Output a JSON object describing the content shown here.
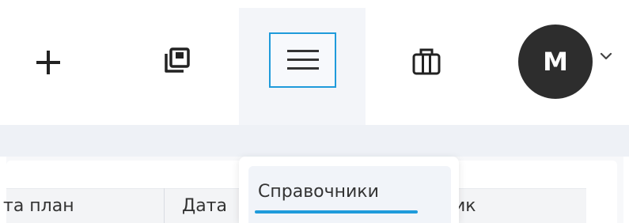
{
  "header": {
    "avatar_initial": "M",
    "icons": [
      "plus-icon",
      "copy-icon",
      "menu-icon",
      "briefcase-icon",
      "chevron-down-icon"
    ],
    "accent_color": "#1f9bdb"
  },
  "table": {
    "columns": [
      "та план",
      "Дата",
      "ик"
    ]
  },
  "dropdown": {
    "items": [
      {
        "label": "Справочники",
        "active": true
      }
    ]
  }
}
